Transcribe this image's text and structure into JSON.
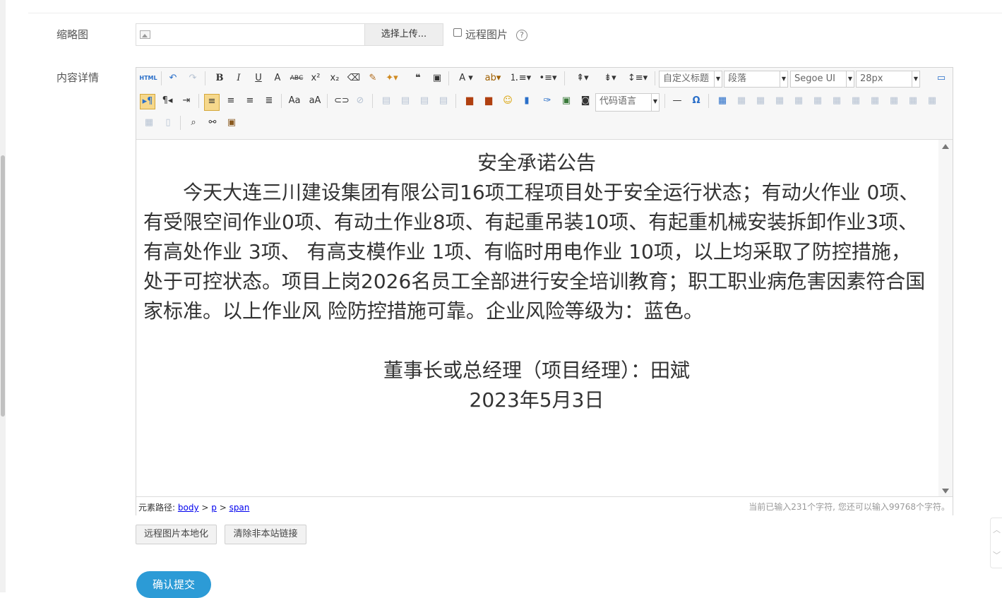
{
  "form": {
    "thumb_label": "缩略图",
    "upload_button": "选择上传...",
    "remote_image_label": "远程图片",
    "help_glyph": "?",
    "content_label": "内容详情"
  },
  "toolbar": {
    "html_label": "HTML",
    "custom_title": "自定义标题",
    "paragraph": "段落",
    "font_family": "Segoe UI",
    "font_size": "28px",
    "code_language": "代码语言"
  },
  "content": {
    "title": "安全承诺公告",
    "body": "今天大连三川建设集团有限公司16项工程项目处于安全运行状态；有动火作业 0项、有受限空间作业0项、有动土作业8项、有起重吊装10项、有起重机械安装拆卸作业3项、有高处作业 3项、 有高支模作业 1项、有临时用电作业 10项，以上均采取了防控措施，处于可控状态。项目上岗2026名员工全部进行安全培训教育；职工职业病危害因素符合国家标准。以上作业风 险防控措施可靠。企业风险等级为：蓝色。",
    "signature": "董事长或总经理（项目经理）：田斌",
    "date": "2023年5月3日"
  },
  "status": {
    "path_label": "元素路径:",
    "path": [
      "body",
      "p",
      "span"
    ],
    "char_count": "当前已输入231个字符, 您还可以输入99768个字符。"
  },
  "actions": {
    "localize_remote": "远程图片本地化",
    "clear_links": "清除非本站链接",
    "submit": "确认提交"
  },
  "colors": {
    "accent": "#2c9bd6",
    "active_button": "#f6d88c",
    "link": "#0000ee"
  }
}
